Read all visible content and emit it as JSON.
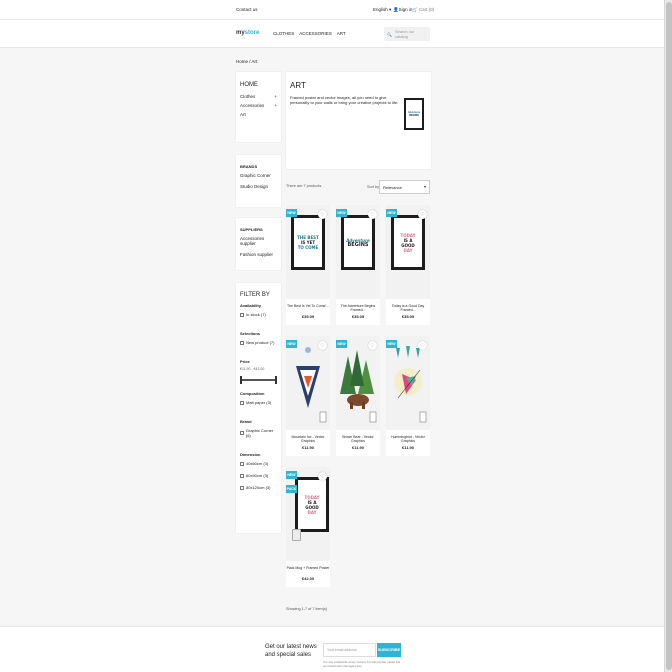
{
  "topbar": {
    "contact": "Contact us",
    "language": "English",
    "signin": "Sign in",
    "cart": "Cart (0)"
  },
  "header": {
    "logo_a": "my",
    "logo_b": "store",
    "menu": [
      "CLOTHES",
      "ACCESSORIES",
      "ART"
    ],
    "search_placeholder": "Search our catalog"
  },
  "breadcrumb": "Home / Art",
  "sidebar": {
    "home": "HOME",
    "categories": [
      {
        "label": "Clothes",
        "toggle": "+"
      },
      {
        "label": "Accessories",
        "toggle": "+"
      },
      {
        "label": "Art",
        "toggle": ""
      }
    ],
    "brands_title": "BRANDS",
    "brands": [
      "Graphic Corner",
      "Studio Design"
    ],
    "suppliers_title": "SUPPLIERS",
    "suppliers": [
      "Accessories supplier",
      "Fashion supplier"
    ],
    "filter_title": "FILTER BY",
    "groups": [
      {
        "label": "Availability",
        "options": [
          "In stock (7)"
        ]
      },
      {
        "label": "Selections",
        "options": [
          "New product (7)"
        ]
      }
    ],
    "price_label": "Price",
    "price_range": "€11.90 - €42.00",
    "groups2": [
      {
        "label": "Composition",
        "options": [
          "Matt paper (3)"
        ]
      },
      {
        "label": "Brand",
        "options": [
          "Graphic Corner (6)"
        ]
      },
      {
        "label": "Dimension",
        "options": [
          "40x60cm (3)",
          "60x90cm (3)",
          "80x120cm (3)"
        ]
      }
    ]
  },
  "category": {
    "title": "ART",
    "description": "Framed poster and vector images, all you need to give personality to your walls or bring your creative projects to life.",
    "thumb_text": [
      "Adventure",
      "BEGINS"
    ]
  },
  "listing": {
    "count": "There are 7 products.",
    "sort_label": "Sort by:",
    "sort_value": "Relevance",
    "showing": "Showing 1-7 of 7 item(s)"
  },
  "products": [
    {
      "name": "The Best Is Yet To Come'...",
      "price": "€35.09",
      "badges": [
        "NEW"
      ],
      "poster": [
        "THE BEST",
        "IS YET",
        "TO COME"
      ]
    },
    {
      "name": "The Adventure Begins Framed...",
      "price": "€35.09",
      "badges": [
        "NEW"
      ],
      "poster": [
        "Adventure",
        "BEGINS"
      ]
    },
    {
      "name": "Today is a Good Day Framed...",
      "price": "€35.09",
      "badges": [
        "NEW"
      ],
      "poster": [
        "TODAY",
        "IS A",
        "GOOD",
        "DAY"
      ]
    },
    {
      "name": "Mountain fox - Vector Graphics",
      "price": "€11.90",
      "badges": [
        "NEW"
      ],
      "poster": []
    },
    {
      "name": "Brown Bear - Vector Graphics",
      "price": "€11.90",
      "badges": [
        "NEW"
      ],
      "poster": []
    },
    {
      "name": "Hummingbird - Vector Graphics",
      "price": "€11.90",
      "badges": [
        "NEW"
      ],
      "poster": []
    },
    {
      "name": "Pack Mug + Framed Poster",
      "price": "€42.00",
      "badges": [
        "NEW",
        "PACK"
      ],
      "poster": [
        "TODAY",
        "IS A",
        "GOOD",
        "DAY"
      ]
    }
  ],
  "footer": {
    "news_title": "Get our latest news and special sales",
    "email_placeholder": "Your email address",
    "subscribe": "SUBSCRIBE",
    "note": "You may unsubscribe at any moment. For that purpose, please find our contact info in the legal notice."
  },
  "colors": {
    "accent": "#2fb5d2",
    "text": "#232323",
    "background": "#f6f6f6"
  }
}
